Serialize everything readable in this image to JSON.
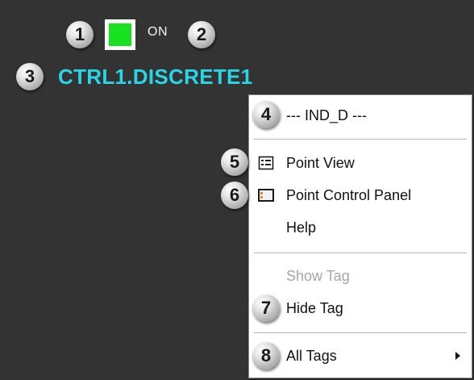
{
  "callouts": [
    "1",
    "2",
    "3",
    "4",
    "5",
    "6",
    "7",
    "8"
  ],
  "widget": {
    "status_text": "ON",
    "tag_name": "CTRL1.DISCRETE1",
    "status_color": "#18e21f",
    "tag_color": "#2ad6e6"
  },
  "menu": {
    "header": "--- IND_D ---",
    "point_view": {
      "label": "Point View",
      "icon": "point-view-icon"
    },
    "point_control_panel": {
      "label": "Point Control Panel",
      "icon": "point-control-panel-icon"
    },
    "help": {
      "label": "Help"
    },
    "show_tag": {
      "label": "Show Tag",
      "enabled": false
    },
    "hide_tag": {
      "label": "Hide Tag"
    },
    "all_tags": {
      "label": "All Tags",
      "has_submenu": true
    }
  }
}
